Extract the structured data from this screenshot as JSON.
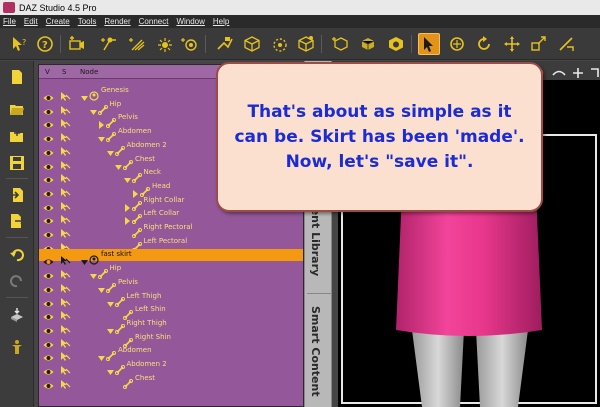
{
  "window": {
    "title": "DAZ Studio 4.5 Pro"
  },
  "menubar": {
    "items": [
      "File",
      "Edit",
      "Create",
      "Tools",
      "Render",
      "Connect",
      "Window",
      "Help"
    ]
  },
  "toolbar": {
    "icons": [
      "whats-this-icon",
      "help-icon",
      "camera-plus-icon",
      "light-spot-icon",
      "light-distant-icon",
      "light-point-icon",
      "light-dial-icon",
      "render-settings-icon",
      "cube-mesh-icon",
      "cube-add-icon",
      "cube-select-icon",
      "cube-star-icon",
      "cube-bounds-icon",
      "node-selection-icon",
      "orbit-icon",
      "rotate-icon",
      "translate-icon",
      "scale-icon",
      "geometry-editor-icon"
    ],
    "active_tool": "node-selection-icon"
  },
  "left_tools": {
    "icons": [
      "new-scene-icon",
      "open-file-icon",
      "merge-file-icon",
      "save-icon",
      "import-icon",
      "export-icon",
      "undo-icon",
      "redo-icon",
      "fit-figure-icon",
      "figure-tool-icon"
    ]
  },
  "scene": {
    "columns": {
      "visible": "V",
      "selectable": "S",
      "node": "Node"
    },
    "nodes": [
      {
        "label": "Genesis",
        "level": 0,
        "expanded": true,
        "type": "figure"
      },
      {
        "label": "Hip",
        "level": 1,
        "expanded": true,
        "type": "bone"
      },
      {
        "label": "Pelvis",
        "level": 2,
        "expanded": false,
        "type": "bone"
      },
      {
        "label": "Abdomen",
        "level": 2,
        "expanded": true,
        "type": "bone"
      },
      {
        "label": "Abdomen 2",
        "level": 3,
        "expanded": true,
        "type": "bone"
      },
      {
        "label": "Chest",
        "level": 4,
        "expanded": true,
        "type": "bone"
      },
      {
        "label": "Neck",
        "level": 5,
        "expanded": true,
        "type": "bone"
      },
      {
        "label": "Head",
        "level": 6,
        "expanded": false,
        "type": "bone"
      },
      {
        "label": "Right Collar",
        "level": 5,
        "expanded": false,
        "type": "bone"
      },
      {
        "label": "Left Collar",
        "level": 5,
        "expanded": false,
        "type": "bone"
      },
      {
        "label": "Right Pectoral",
        "level": 5,
        "expanded": null,
        "type": "bone"
      },
      {
        "label": "Left Pectoral",
        "level": 5,
        "expanded": null,
        "type": "bone"
      },
      {
        "label": "fast skirt",
        "level": 0,
        "expanded": true,
        "type": "figure",
        "selected": true
      },
      {
        "label": "Hip",
        "level": 1,
        "expanded": true,
        "type": "bone"
      },
      {
        "label": "Pelvis",
        "level": 2,
        "expanded": true,
        "type": "bone"
      },
      {
        "label": "Left Thigh",
        "level": 3,
        "expanded": true,
        "type": "bone"
      },
      {
        "label": "Left Shin",
        "level": 4,
        "expanded": null,
        "type": "bone"
      },
      {
        "label": "Right Thigh",
        "level": 3,
        "expanded": true,
        "type": "bone"
      },
      {
        "label": "Right Shin",
        "level": 4,
        "expanded": null,
        "type": "bone"
      },
      {
        "label": "Abdomen",
        "level": 2,
        "expanded": true,
        "type": "bone"
      },
      {
        "label": "Abdomen 2",
        "level": 3,
        "expanded": true,
        "type": "bone"
      },
      {
        "label": "Chest",
        "level": 4,
        "expanded": null,
        "type": "bone"
      }
    ]
  },
  "side_tabs": {
    "content_library": "Content Library",
    "smart_content": "Smart Content"
  },
  "callout": {
    "text": "That's about as simple as it can be. Skirt has been 'made'. Now, let's \"save it\"."
  },
  "colors": {
    "accent": "#f39a10",
    "scene_bg": "#94579a",
    "node_text": "#f7e07a",
    "callout_text": "#1b2bd6",
    "skirt": "#e0358a"
  }
}
